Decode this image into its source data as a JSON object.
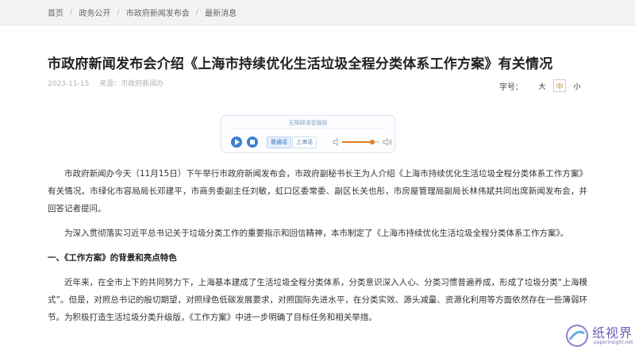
{
  "breadcrumb": {
    "items": [
      "首页",
      "政务公开",
      "市政府新闻发布会",
      "最新消息"
    ],
    "separator": "/"
  },
  "article_header": {
    "title": "市政府新闻发布会介绍《上海市持续优化生活垃圾全程分类体系工作方案》有关情况",
    "date": "2023-11-15",
    "source": "来源：市政府新闻办"
  },
  "font_size": {
    "label": "字号：",
    "options": [
      "大",
      "中",
      "小"
    ],
    "selected": "中"
  },
  "audio_player": {
    "caption": "无障碍语音播报",
    "lang_mandarin": "普通话",
    "lang_shanghai": "上海话",
    "volume_level": 0.8,
    "accent_color": "#3d7fd2",
    "volume_color": "#e67e22"
  },
  "article_body": {
    "p1": "市政府新闻办今天（11月15日）下午举行市政府新闻发布会，市政府副秘书长王为人介绍《上海市持续优化生活垃圾全程分类体系工作方案》有关情况。市绿化市容局局长邓建平，市商务委副主任刘敏，虹口区委常委、副区长关也彤，市房屋管理局副局长林伟斌共同出席新闻发布会，并回答记者提问。",
    "p2": "为深入贯彻落实习近平总书记关于垃圾分类工作的重要指示和回信精神，本市制定了《上海市持续优化生活垃圾全程分类体系工作方案》。",
    "section_heading": "一、《工作方案》的背景和亮点特色",
    "p3": "近年来，在全市上下的共同努力下，上海基本建成了生活垃圾全程分类体系，分类意识深入人心、分类习惯普遍养成，形成了垃圾分类“上海模式”。但是，对照总书记的殷切期望，对照绿色低碳发展要求，对照国际先进水平，在分类实效、源头减量、资源化利用等方面依然存在一些薄弱环节。为积极打造生活垃圾分类升级版，《工作方案》中进一步明确了目标任务和相关举措。"
  },
  "watermark": {
    "text": "纸视界",
    "url": "paperinsight.net"
  }
}
